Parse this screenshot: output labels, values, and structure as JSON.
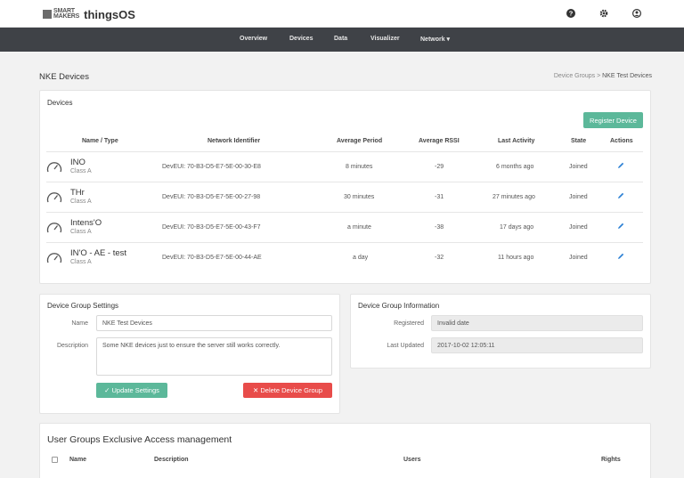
{
  "header": {
    "logo_line1": "SMART",
    "logo_line2": "MAKERS",
    "app_title": "thingsOS",
    "icons": [
      "help-icon",
      "gear-icon",
      "user-icon"
    ]
  },
  "nav": {
    "items": [
      "Overview",
      "Devices",
      "Data",
      "Visualizer",
      "Network ▾"
    ]
  },
  "page": {
    "title": "NKE Devices",
    "breadcrumb_parent": "Device Groups",
    "breadcrumb_sep": ">",
    "breadcrumb_current": "NKE Test Devices"
  },
  "devices": {
    "title": "Devices",
    "register_button": "Register Device",
    "columns": [
      "Name / Type",
      "Network Identifier",
      "Average Period",
      "Average RSSI",
      "Last Activity",
      "State",
      "Actions"
    ],
    "rows": [
      {
        "name": "INO",
        "class": "Class A",
        "id": "DevEUI: 70-B3-D5-E7-5E-00-30-E8",
        "period": "8 minutes",
        "rssi": "-29",
        "last": "6 months ago",
        "state": "Joined"
      },
      {
        "name": "THr",
        "class": "Class A",
        "id": "DevEUI: 70-B3-D5-E7-5E-00-27-98",
        "period": "30 minutes",
        "rssi": "-31",
        "last": "27 minutes ago",
        "state": "Joined"
      },
      {
        "name": "Intens'O",
        "class": "Class A",
        "id": "DevEUI: 70-B3-D5-E7-5E-00-43-F7",
        "period": "a minute",
        "rssi": "-38",
        "last": "17 days ago",
        "state": "Joined"
      },
      {
        "name": "IN'O - AE - test",
        "class": "Class A",
        "id": "DevEUI: 70-B3-D5-E7-5E-00-44-AE",
        "period": "a day",
        "rssi": "-32",
        "last": "11 hours ago",
        "state": "Joined"
      }
    ]
  },
  "settings": {
    "title": "Device Group Settings",
    "name_label": "Name",
    "name_value": "NKE Test Devices",
    "description_label": "Description",
    "description_value": "Some NKE devices just to ensure the server still works correctly.",
    "update_button": "✓ Update Settings",
    "delete_button": "✕ Delete Device Group"
  },
  "info": {
    "title": "Device Group Information",
    "registered_label": "Registered",
    "registered_value": "Invalid date",
    "updated_label": "Last Updated",
    "updated_value": "2017-10-02 12:05:11"
  },
  "user_groups": {
    "title": "User Groups Exclusive Access management",
    "columns": [
      "Name",
      "Description",
      "Users",
      "Rights"
    ]
  },
  "colors": {
    "nav_bg": "#3f4247",
    "accent_green": "#5cb89a",
    "danger_red": "#e84c4a",
    "edit_blue": "#2a7fd4"
  }
}
